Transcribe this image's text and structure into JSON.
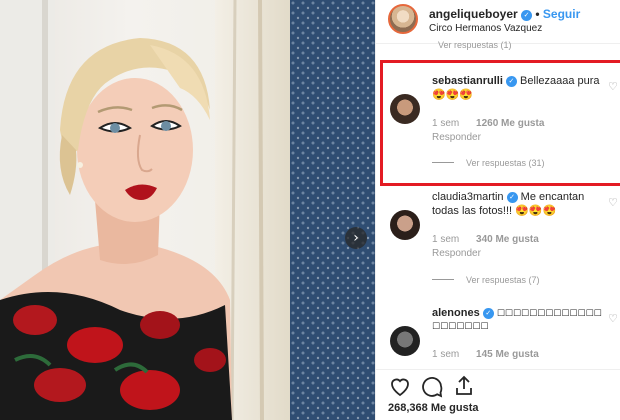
{
  "post": {
    "username": "angeliqueboyer",
    "follow_label": "Seguir",
    "location": "Circo Hermanos Vazquez",
    "likes": "268,368 Me gusta"
  },
  "partial_reply": "Ver respuestas (1)",
  "comments": [
    {
      "user": "sebastianrulli",
      "text": "Bellezaaaa pura",
      "emojis": "😍😍😍",
      "time": "1 sem",
      "likes": "1260 Me gusta",
      "reply": "Responder",
      "more": "Ver respuestas (31)"
    },
    {
      "user": "claudia3martin",
      "text": "Me encantan",
      "text2": "todas las fotos!!! 😍😍😍",
      "time": "1 sem",
      "likes": "340 Me gusta",
      "reply": "Responder",
      "more": "Ver respuestas (7)"
    },
    {
      "user": "alenones",
      "text": "☐☐☐☐☐☐☐☐☐☐☐☐☐",
      "text2": "☐☐☐☐☐☐☐",
      "time": "1 sem",
      "likes": "145 Me gusta"
    }
  ],
  "icons": {
    "verified": "verified-badge-icon",
    "like": "heart-icon",
    "comment": "comment-bubble-icon",
    "share": "share-arrow-icon",
    "next": "chevron-right-icon"
  },
  "colors": {
    "accent_blue": "#3897f0",
    "highlight_red": "#e31b23",
    "muted": "#999999"
  }
}
